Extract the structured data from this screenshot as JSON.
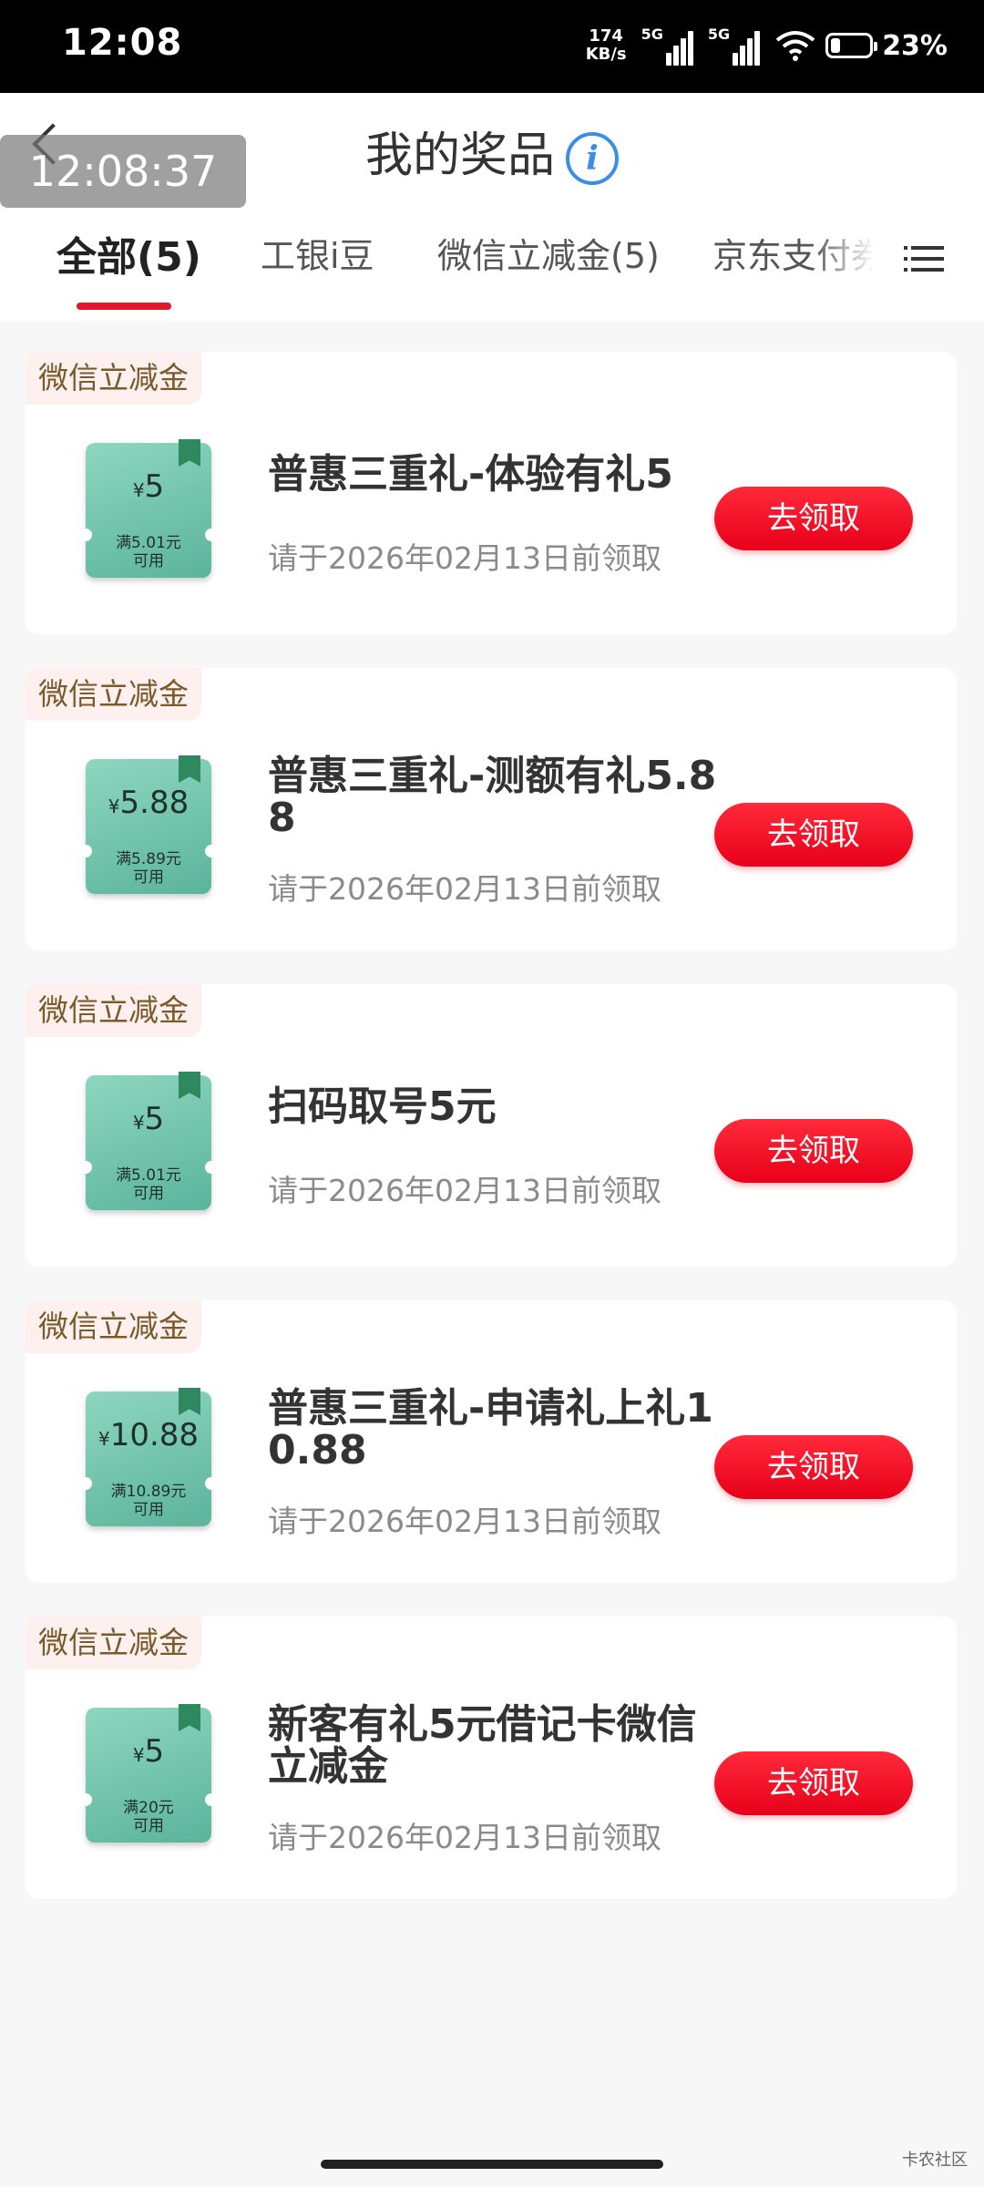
{
  "status_bar": {
    "time": "12:08",
    "speed_value": "174",
    "speed_unit": "KB/s",
    "sim1": "5G",
    "sim2": "5G",
    "battery": "23%"
  },
  "header": {
    "title": "我的奖品",
    "timer": "12:08:37",
    "back_icon": "chevron-left-icon",
    "info_icon": "info-icon",
    "info_glyph": "i"
  },
  "tabs": [
    {
      "label": "全部(5)",
      "active": true
    },
    {
      "label": "工银i豆",
      "active": false
    },
    {
      "label": "微信立减金(5)",
      "active": false
    },
    {
      "label": "京东支付券",
      "active": false
    }
  ],
  "colors": {
    "accent": "#e0182d",
    "button": "#ff1e32",
    "coupon": "#6cc2a8",
    "tag_bg": "#fdf0ee",
    "tag_text": "#7a5a2a"
  },
  "prizes": [
    {
      "tag": "微信立减金",
      "symbol": "¥",
      "amount": "5",
      "cond1": "满5.01元",
      "cond2": "可用",
      "title": "普惠三重礼-体验有礼5",
      "expiry": "请于2026年02月13日前领取",
      "button": "去领取"
    },
    {
      "tag": "微信立减金",
      "symbol": "¥",
      "amount": "5.88",
      "cond1": "满5.89元",
      "cond2": "可用",
      "title": "普惠三重礼-测额有礼5.8\n8",
      "expiry": "请于2026年02月13日前领取",
      "button": "去领取"
    },
    {
      "tag": "微信立减金",
      "symbol": "¥",
      "amount": "5",
      "cond1": "满5.01元",
      "cond2": "可用",
      "title": "扫码取号5元",
      "expiry": "请于2026年02月13日前领取",
      "button": "去领取"
    },
    {
      "tag": "微信立减金",
      "symbol": "¥",
      "amount": "10.88",
      "cond1": "满10.89元",
      "cond2": "可用",
      "title": "普惠三重礼-申请礼上礼1\n0.88",
      "expiry": "请于2026年02月13日前领取",
      "button": "去领取"
    },
    {
      "tag": "微信立减金",
      "symbol": "¥",
      "amount": "5",
      "cond1": "满20元",
      "cond2": "可用",
      "title": "新客有礼5元借记卡微信\n立减金",
      "expiry": "请于2026年02月13日前领取",
      "button": "去领取"
    }
  ],
  "watermark": "卡农社区"
}
